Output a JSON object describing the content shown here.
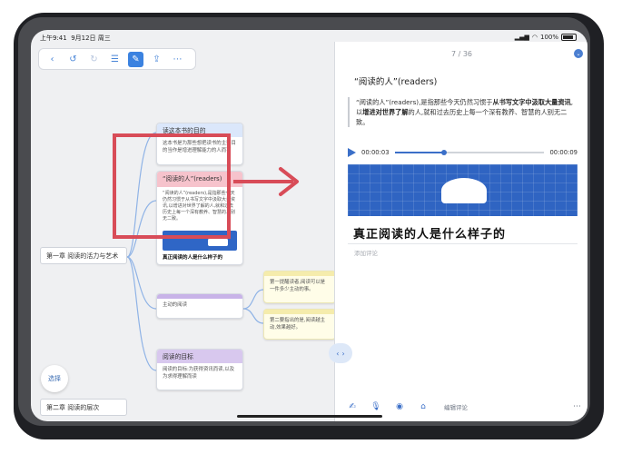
{
  "status": {
    "time": "上午9:41",
    "date": "9月12日 周三",
    "battery": "100%"
  },
  "toolbar": {
    "buttons": [
      "chevron-left-icon",
      "undo-icon",
      "redo-icon",
      "list-icon",
      "edit-icon",
      "share-icon",
      "more-icon"
    ]
  },
  "mindmap": {
    "chapter1": "第一章 阅读的活力与艺术",
    "chapter2": "第二章 阅读的层次",
    "node_purpose": {
      "title": "读这本书的目的",
      "body": "这本书是为那些想把读书的主要目的当作是增进理解能力的人而写"
    },
    "node_readers": {
      "title": "“阅读的人”(readers)",
      "body": "“阅读的人”(readers),是指那些今天仍然习惯于从书写文字中汲取大量资讯,以增进对世界了解的人,就和过去历史上每一个深有教养、智慧的人别无二致。",
      "caption": "真正阅读的人是什么样子的"
    },
    "node_active": {
      "title": "",
      "body": "主动的阅读"
    },
    "node_goal": {
      "title": "阅读的目标",
      "body": "阅读的目标:为获得资讯而读,以及为求得理解而读"
    },
    "note1": "第一提醒读者,阅读可以是一件多少主动的事。",
    "note2": "第二要指出的是,阅读越主动,效果越好。",
    "select_label": "选择"
  },
  "panel": {
    "page": "7 / 36",
    "title": "“阅读的人”(readers)",
    "quote_pre": "“阅读的人”(readers),是指那些今天仍然习惯于",
    "quote_bold1": "从书写文字中汲取大量资讯",
    "quote_mid": ",以",
    "quote_bold2": "增进对世界了解",
    "quote_post": "的人,就和过去历史上每一个深有教养、智慧的人别无二致。",
    "audio": {
      "current": "00:00:03",
      "total": "00:00:09",
      "progress": 0.33
    },
    "handwriting": "真正阅读的人是什么样子的",
    "add_comment": "添加评论",
    "edit_comment": "编辑评论"
  },
  "colors": {
    "accent": "#3b82e0",
    "highlight": "#d84c58"
  }
}
